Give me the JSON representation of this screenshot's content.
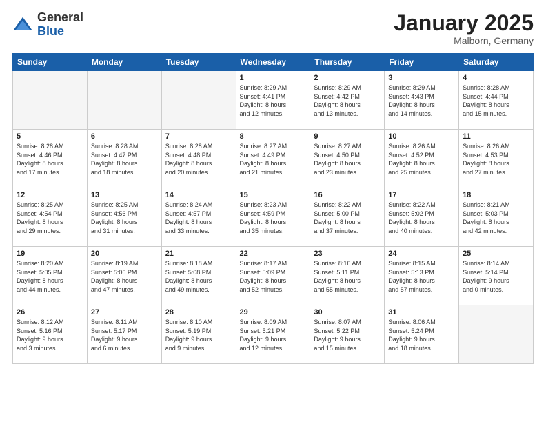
{
  "header": {
    "logo_general": "General",
    "logo_blue": "Blue",
    "month_title": "January 2025",
    "location": "Malborn, Germany"
  },
  "weekdays": [
    "Sunday",
    "Monday",
    "Tuesday",
    "Wednesday",
    "Thursday",
    "Friday",
    "Saturday"
  ],
  "weeks": [
    [
      {
        "day": "",
        "info": ""
      },
      {
        "day": "",
        "info": ""
      },
      {
        "day": "",
        "info": ""
      },
      {
        "day": "1",
        "info": "Sunrise: 8:29 AM\nSunset: 4:41 PM\nDaylight: 8 hours\nand 12 minutes."
      },
      {
        "day": "2",
        "info": "Sunrise: 8:29 AM\nSunset: 4:42 PM\nDaylight: 8 hours\nand 13 minutes."
      },
      {
        "day": "3",
        "info": "Sunrise: 8:29 AM\nSunset: 4:43 PM\nDaylight: 8 hours\nand 14 minutes."
      },
      {
        "day": "4",
        "info": "Sunrise: 8:28 AM\nSunset: 4:44 PM\nDaylight: 8 hours\nand 15 minutes."
      }
    ],
    [
      {
        "day": "5",
        "info": "Sunrise: 8:28 AM\nSunset: 4:46 PM\nDaylight: 8 hours\nand 17 minutes."
      },
      {
        "day": "6",
        "info": "Sunrise: 8:28 AM\nSunset: 4:47 PM\nDaylight: 8 hours\nand 18 minutes."
      },
      {
        "day": "7",
        "info": "Sunrise: 8:28 AM\nSunset: 4:48 PM\nDaylight: 8 hours\nand 20 minutes."
      },
      {
        "day": "8",
        "info": "Sunrise: 8:27 AM\nSunset: 4:49 PM\nDaylight: 8 hours\nand 21 minutes."
      },
      {
        "day": "9",
        "info": "Sunrise: 8:27 AM\nSunset: 4:50 PM\nDaylight: 8 hours\nand 23 minutes."
      },
      {
        "day": "10",
        "info": "Sunrise: 8:26 AM\nSunset: 4:52 PM\nDaylight: 8 hours\nand 25 minutes."
      },
      {
        "day": "11",
        "info": "Sunrise: 8:26 AM\nSunset: 4:53 PM\nDaylight: 8 hours\nand 27 minutes."
      }
    ],
    [
      {
        "day": "12",
        "info": "Sunrise: 8:25 AM\nSunset: 4:54 PM\nDaylight: 8 hours\nand 29 minutes."
      },
      {
        "day": "13",
        "info": "Sunrise: 8:25 AM\nSunset: 4:56 PM\nDaylight: 8 hours\nand 31 minutes."
      },
      {
        "day": "14",
        "info": "Sunrise: 8:24 AM\nSunset: 4:57 PM\nDaylight: 8 hours\nand 33 minutes."
      },
      {
        "day": "15",
        "info": "Sunrise: 8:23 AM\nSunset: 4:59 PM\nDaylight: 8 hours\nand 35 minutes."
      },
      {
        "day": "16",
        "info": "Sunrise: 8:22 AM\nSunset: 5:00 PM\nDaylight: 8 hours\nand 37 minutes."
      },
      {
        "day": "17",
        "info": "Sunrise: 8:22 AM\nSunset: 5:02 PM\nDaylight: 8 hours\nand 40 minutes."
      },
      {
        "day": "18",
        "info": "Sunrise: 8:21 AM\nSunset: 5:03 PM\nDaylight: 8 hours\nand 42 minutes."
      }
    ],
    [
      {
        "day": "19",
        "info": "Sunrise: 8:20 AM\nSunset: 5:05 PM\nDaylight: 8 hours\nand 44 minutes."
      },
      {
        "day": "20",
        "info": "Sunrise: 8:19 AM\nSunset: 5:06 PM\nDaylight: 8 hours\nand 47 minutes."
      },
      {
        "day": "21",
        "info": "Sunrise: 8:18 AM\nSunset: 5:08 PM\nDaylight: 8 hours\nand 49 minutes."
      },
      {
        "day": "22",
        "info": "Sunrise: 8:17 AM\nSunset: 5:09 PM\nDaylight: 8 hours\nand 52 minutes."
      },
      {
        "day": "23",
        "info": "Sunrise: 8:16 AM\nSunset: 5:11 PM\nDaylight: 8 hours\nand 55 minutes."
      },
      {
        "day": "24",
        "info": "Sunrise: 8:15 AM\nSunset: 5:13 PM\nDaylight: 8 hours\nand 57 minutes."
      },
      {
        "day": "25",
        "info": "Sunrise: 8:14 AM\nSunset: 5:14 PM\nDaylight: 9 hours\nand 0 minutes."
      }
    ],
    [
      {
        "day": "26",
        "info": "Sunrise: 8:12 AM\nSunset: 5:16 PM\nDaylight: 9 hours\nand 3 minutes."
      },
      {
        "day": "27",
        "info": "Sunrise: 8:11 AM\nSunset: 5:17 PM\nDaylight: 9 hours\nand 6 minutes."
      },
      {
        "day": "28",
        "info": "Sunrise: 8:10 AM\nSunset: 5:19 PM\nDaylight: 9 hours\nand 9 minutes."
      },
      {
        "day": "29",
        "info": "Sunrise: 8:09 AM\nSunset: 5:21 PM\nDaylight: 9 hours\nand 12 minutes."
      },
      {
        "day": "30",
        "info": "Sunrise: 8:07 AM\nSunset: 5:22 PM\nDaylight: 9 hours\nand 15 minutes."
      },
      {
        "day": "31",
        "info": "Sunrise: 8:06 AM\nSunset: 5:24 PM\nDaylight: 9 hours\nand 18 minutes."
      },
      {
        "day": "",
        "info": ""
      }
    ]
  ]
}
